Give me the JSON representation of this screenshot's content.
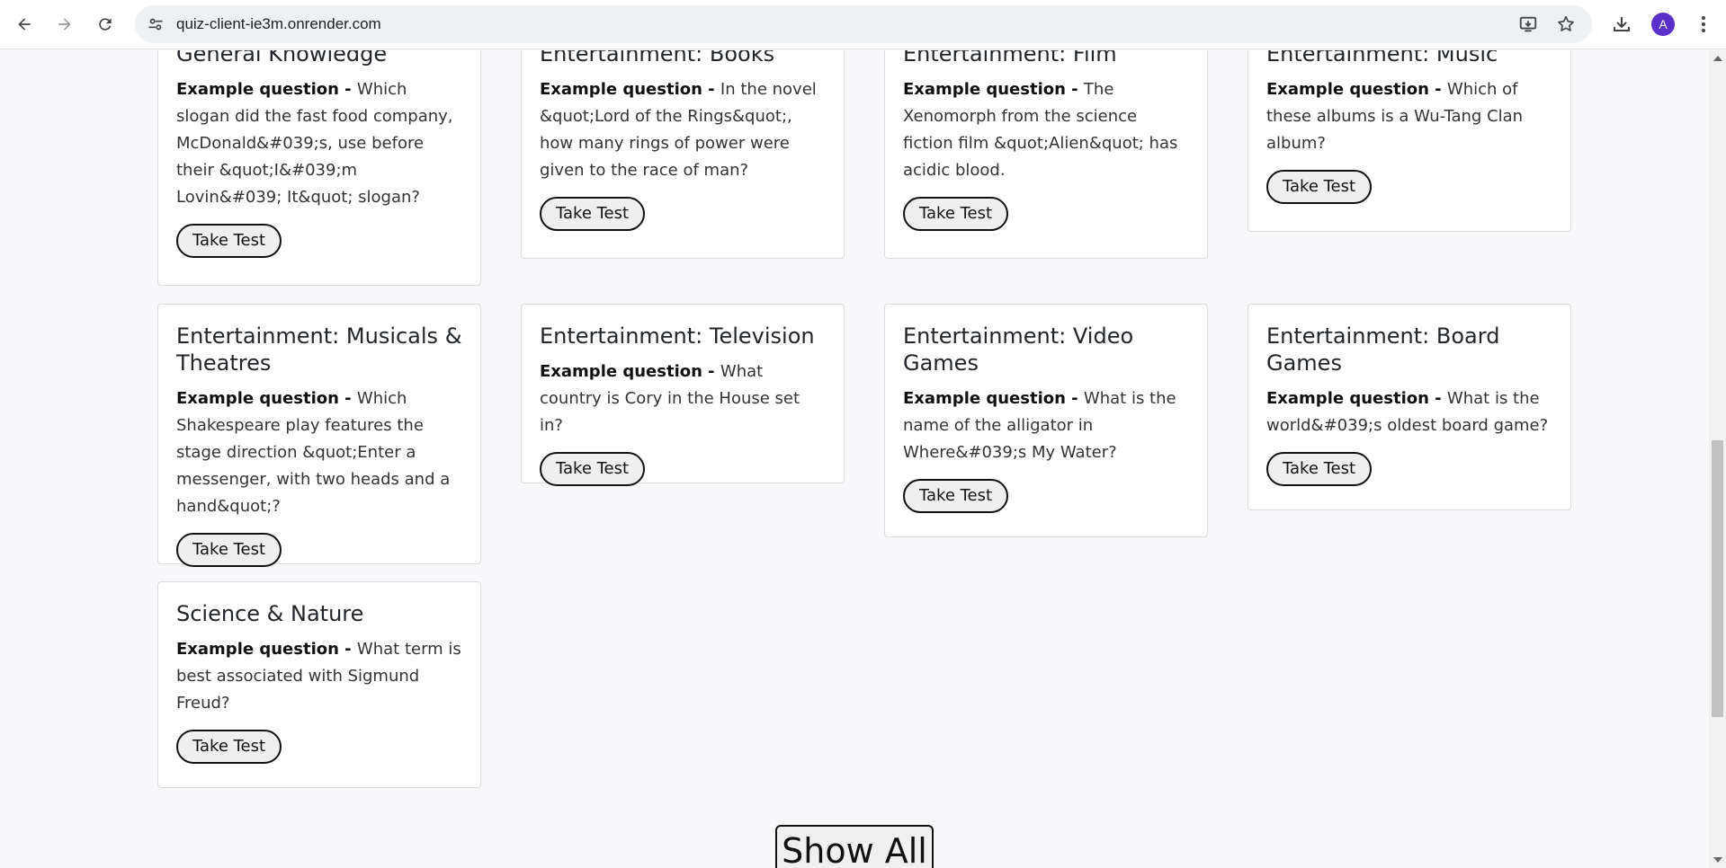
{
  "browser": {
    "url": "quiz-client-ie3m.onrender.com",
    "profile_initial": "A",
    "accent_color": "#5b2fc9"
  },
  "icons": {
    "back": "arrow-left-icon",
    "forward": "arrow-right-icon",
    "reload": "reload-icon",
    "site_info": "tune-icon",
    "install": "install-app-icon",
    "bookmark": "star-icon",
    "downloads": "download-icon",
    "menu": "kebab-menu-icon"
  },
  "example_prefix": "Example question - ",
  "take_test_label": "Take Test",
  "show_all_label": "Show All",
  "cards": [
    {
      "title": "General Knowledge",
      "question": "Which slogan did the fast food company, McDonald&#039;s, use before their &quot;I&#039;m Lovin&#039; It&quot; slogan?"
    },
    {
      "title": "Entertainment: Books",
      "question": "In the novel &quot;Lord of the Rings&quot;, how many rings of power were given to the race of man?"
    },
    {
      "title": "Entertainment: Film",
      "question": "The Xenomorph from the science fiction film &quot;Alien&quot; has acidic blood."
    },
    {
      "title": "Entertainment: Music",
      "question": "Which of these albums is a Wu-Tang Clan album?"
    },
    {
      "title": "Entertainment: Musicals & Theatres",
      "question": "Which Shakespeare play features the stage direction &quot;Enter a messenger, with two heads and a hand&quot;?"
    },
    {
      "title": "Entertainment: Television",
      "question": "What country is Cory in the House set in?"
    },
    {
      "title": "Entertainment: Video Games",
      "question": "What is the name of the alligator in Where&#039;s My Water?"
    },
    {
      "title": "Entertainment: Board Games",
      "question": "What is the world&#039;s oldest board game?"
    },
    {
      "title": "Science & Nature",
      "question": "What term is best associated with Sigmund Freud?"
    }
  ]
}
